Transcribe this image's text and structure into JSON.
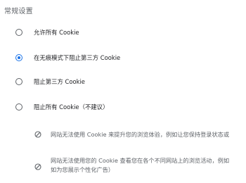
{
  "section": {
    "title": "常规设置"
  },
  "options": [
    {
      "label": "允许所有 Cookie",
      "checked": false
    },
    {
      "label": "在无痕模式下阻止第三方 Cookie",
      "checked": true
    },
    {
      "label": "阻止第三方 Cookie",
      "checked": false
    },
    {
      "label": "阻止所有 Cookie（不建议）",
      "checked": false
    }
  ],
  "block_all_notes": [
    {
      "icon": "block-icon",
      "text": "网站无法使用 Cookie 来提升您的浏览体验，例如让您保持登录状态或"
    },
    {
      "icon": "block-icon",
      "text_line1": "网站无法使用您的 Cookie 查看您在各个不同网站上的浏览活动，例如",
      "text_line2": "如为您展示个性化广告）"
    }
  ]
}
